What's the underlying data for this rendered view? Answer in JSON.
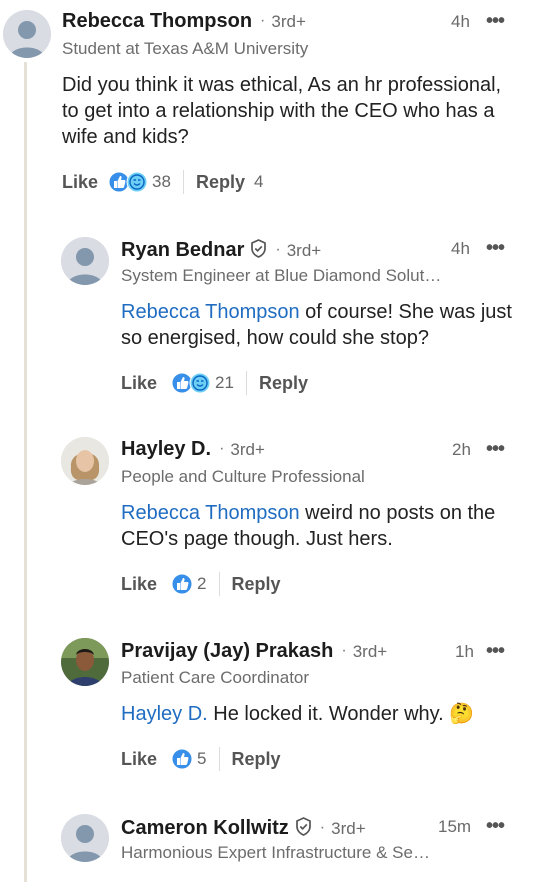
{
  "comments": [
    {
      "name": "Rebecca Thompson",
      "degree": "3rd+",
      "time": "4h",
      "headline": "Student at Texas A&M University",
      "text": "Did you think it was ethical, As an hr professional, to get into a relationship with the CEO who has a wife and kids?",
      "like_label": "Like",
      "reaction_count": "38",
      "reply_label": "Reply",
      "reply_count": "4",
      "reactions": [
        "like-icon",
        "support-icon"
      ]
    },
    {
      "name": "Ryan Bednar",
      "degree": "3rd+",
      "time": "4h",
      "headline": "System Engineer at Blue Diamond Solut…",
      "mention": "Rebecca Thompson",
      "text": " of course! She was just so energised, how could she stop?",
      "like_label": "Like",
      "reaction_count": "21",
      "reply_label": "Reply",
      "reactions": [
        "like-icon",
        "support-icon"
      ]
    },
    {
      "name": "Hayley D.",
      "degree": "3rd+",
      "time": "2h",
      "headline": "People and Culture Professional",
      "mention": "Rebecca Thompson",
      "text": " weird no posts on the CEO's page though. Just hers.",
      "like_label": "Like",
      "reaction_count": "2",
      "reply_label": "Reply",
      "reactions": [
        "like-icon"
      ]
    },
    {
      "name": "Pravijay (Jay) Prakash",
      "degree": "3rd+",
      "time": "1h",
      "headline": "Patient Care Coordinator",
      "mention": "Hayley D.",
      "text": " He locked it. Wonder why. 🤔",
      "like_label": "Like",
      "reaction_count": "5",
      "reply_label": "Reply",
      "reactions": [
        "like-icon"
      ]
    },
    {
      "name": "Cameron Kollwitz",
      "degree": "3rd+",
      "time": "15m",
      "headline": "Harmonious Expert Infrastructure & Se…"
    }
  ],
  "more_glyph": "•••",
  "dot_glyph": "·",
  "colors": {
    "link": "#1f6cc1",
    "like_blue": "#378fe9",
    "thread_line": "#e6e1d6"
  }
}
